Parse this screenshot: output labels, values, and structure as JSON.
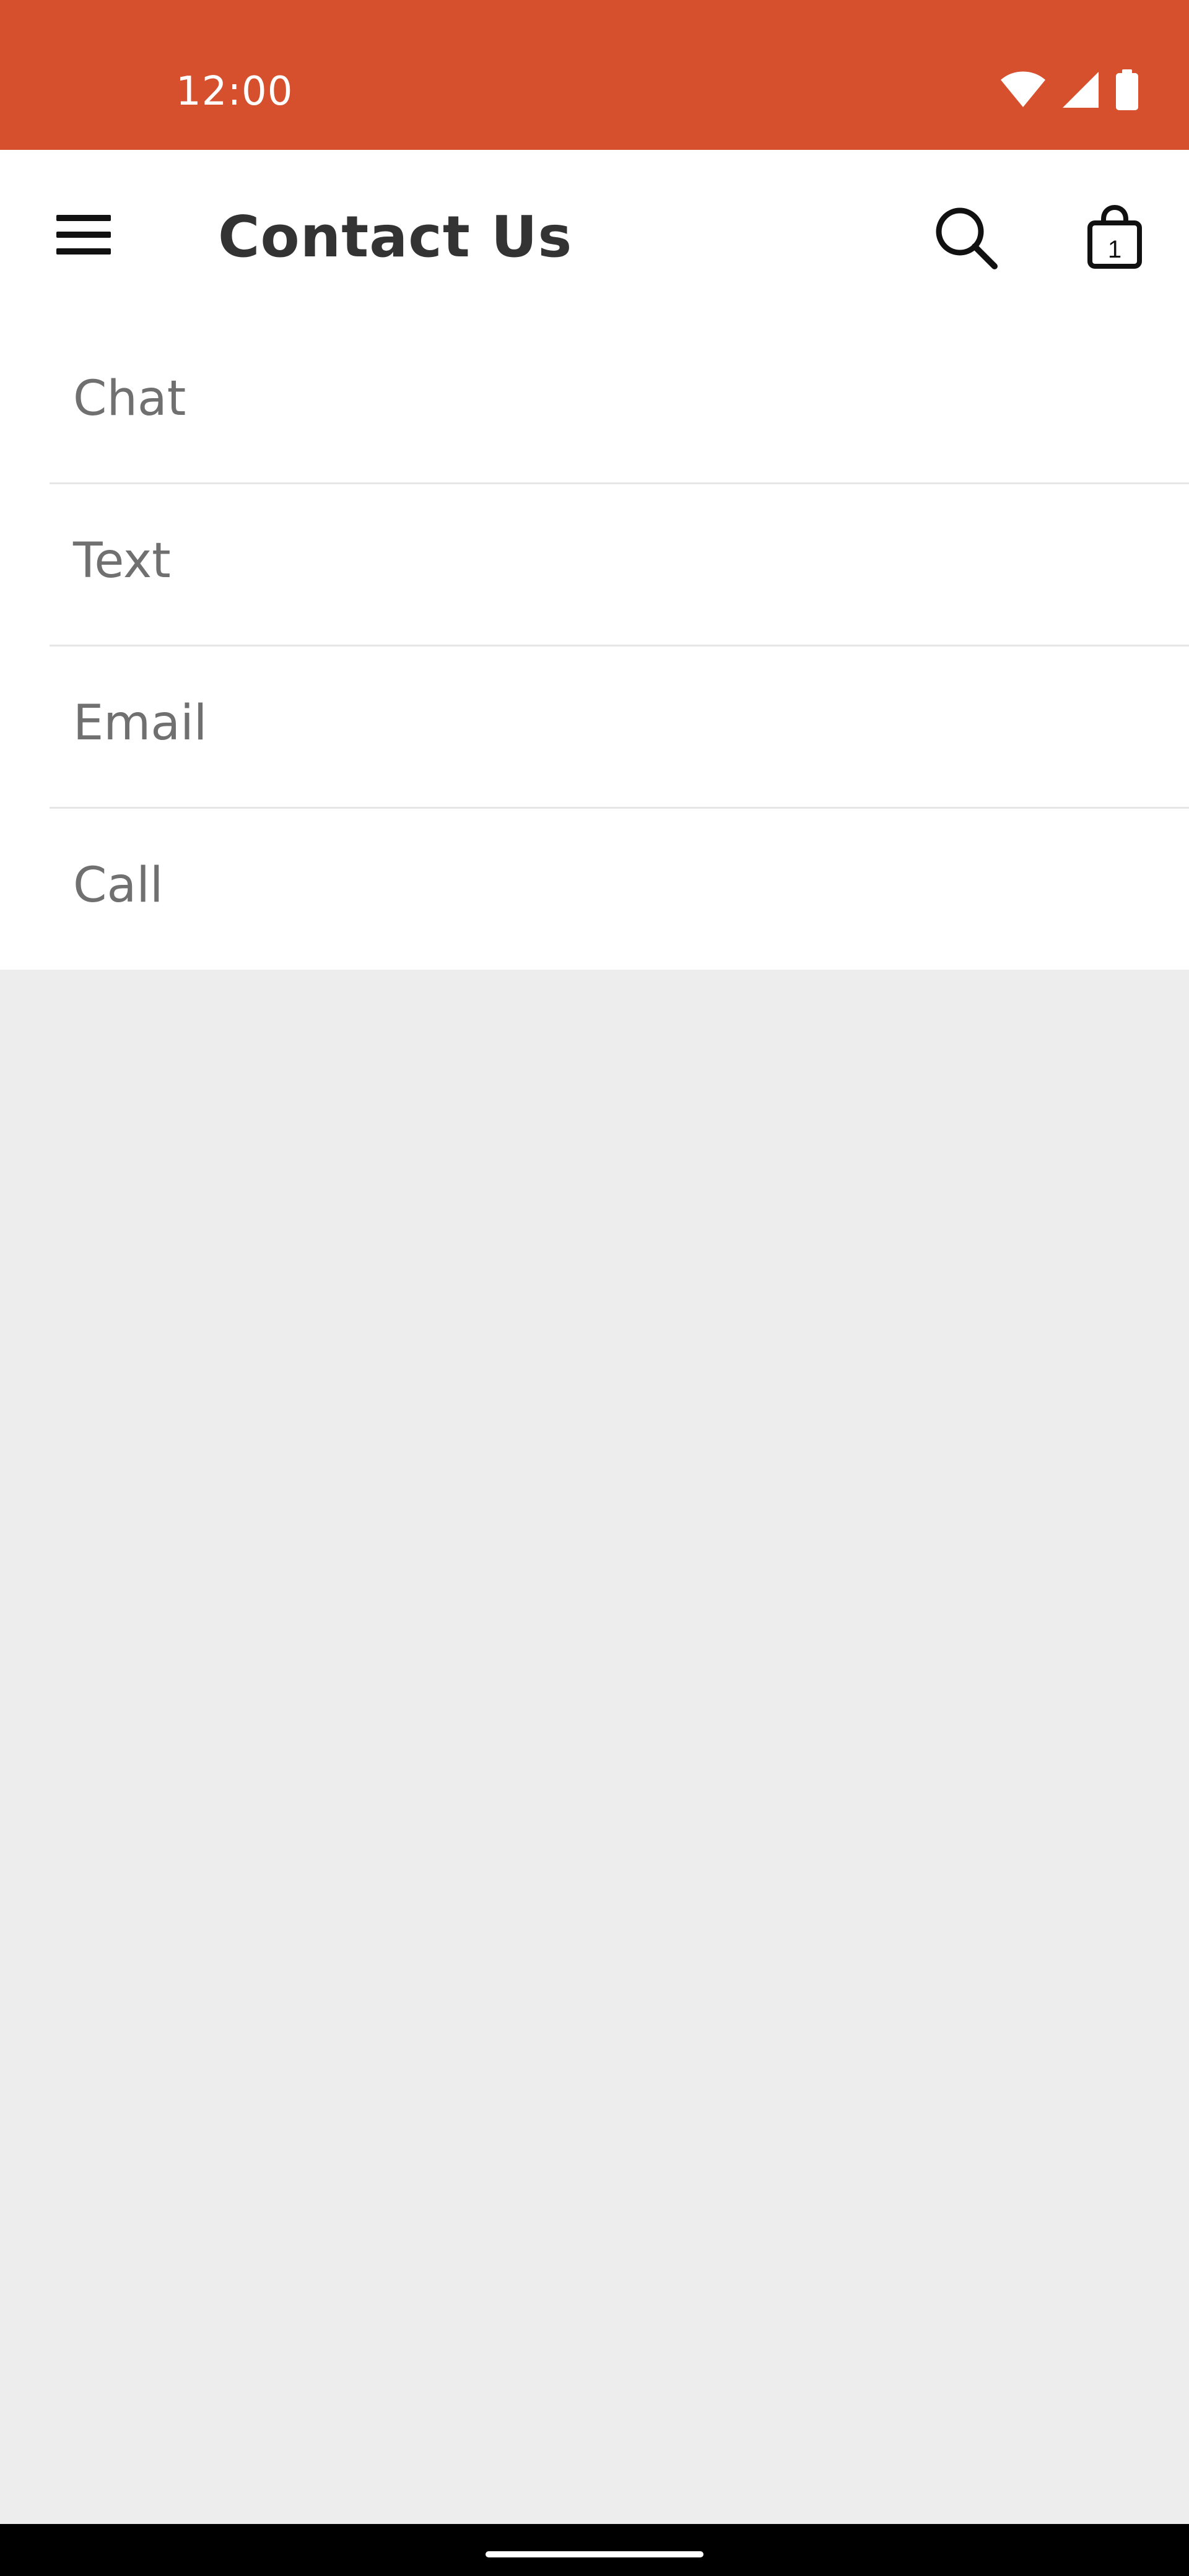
{
  "status_bar": {
    "time": "12:00",
    "background_color": "#d6502e",
    "icons": [
      "wifi-icon",
      "signal-icon",
      "battery-icon"
    ]
  },
  "app_bar": {
    "title": "Contact Us",
    "menu_icon": "hamburger-menu-icon",
    "search_icon": "search-icon",
    "cart_icon": "shopping-bag-icon",
    "cart_count": "1"
  },
  "contact_options": [
    {
      "label": "Chat"
    },
    {
      "label": "Text"
    },
    {
      "label": "Email"
    },
    {
      "label": "Call"
    }
  ]
}
